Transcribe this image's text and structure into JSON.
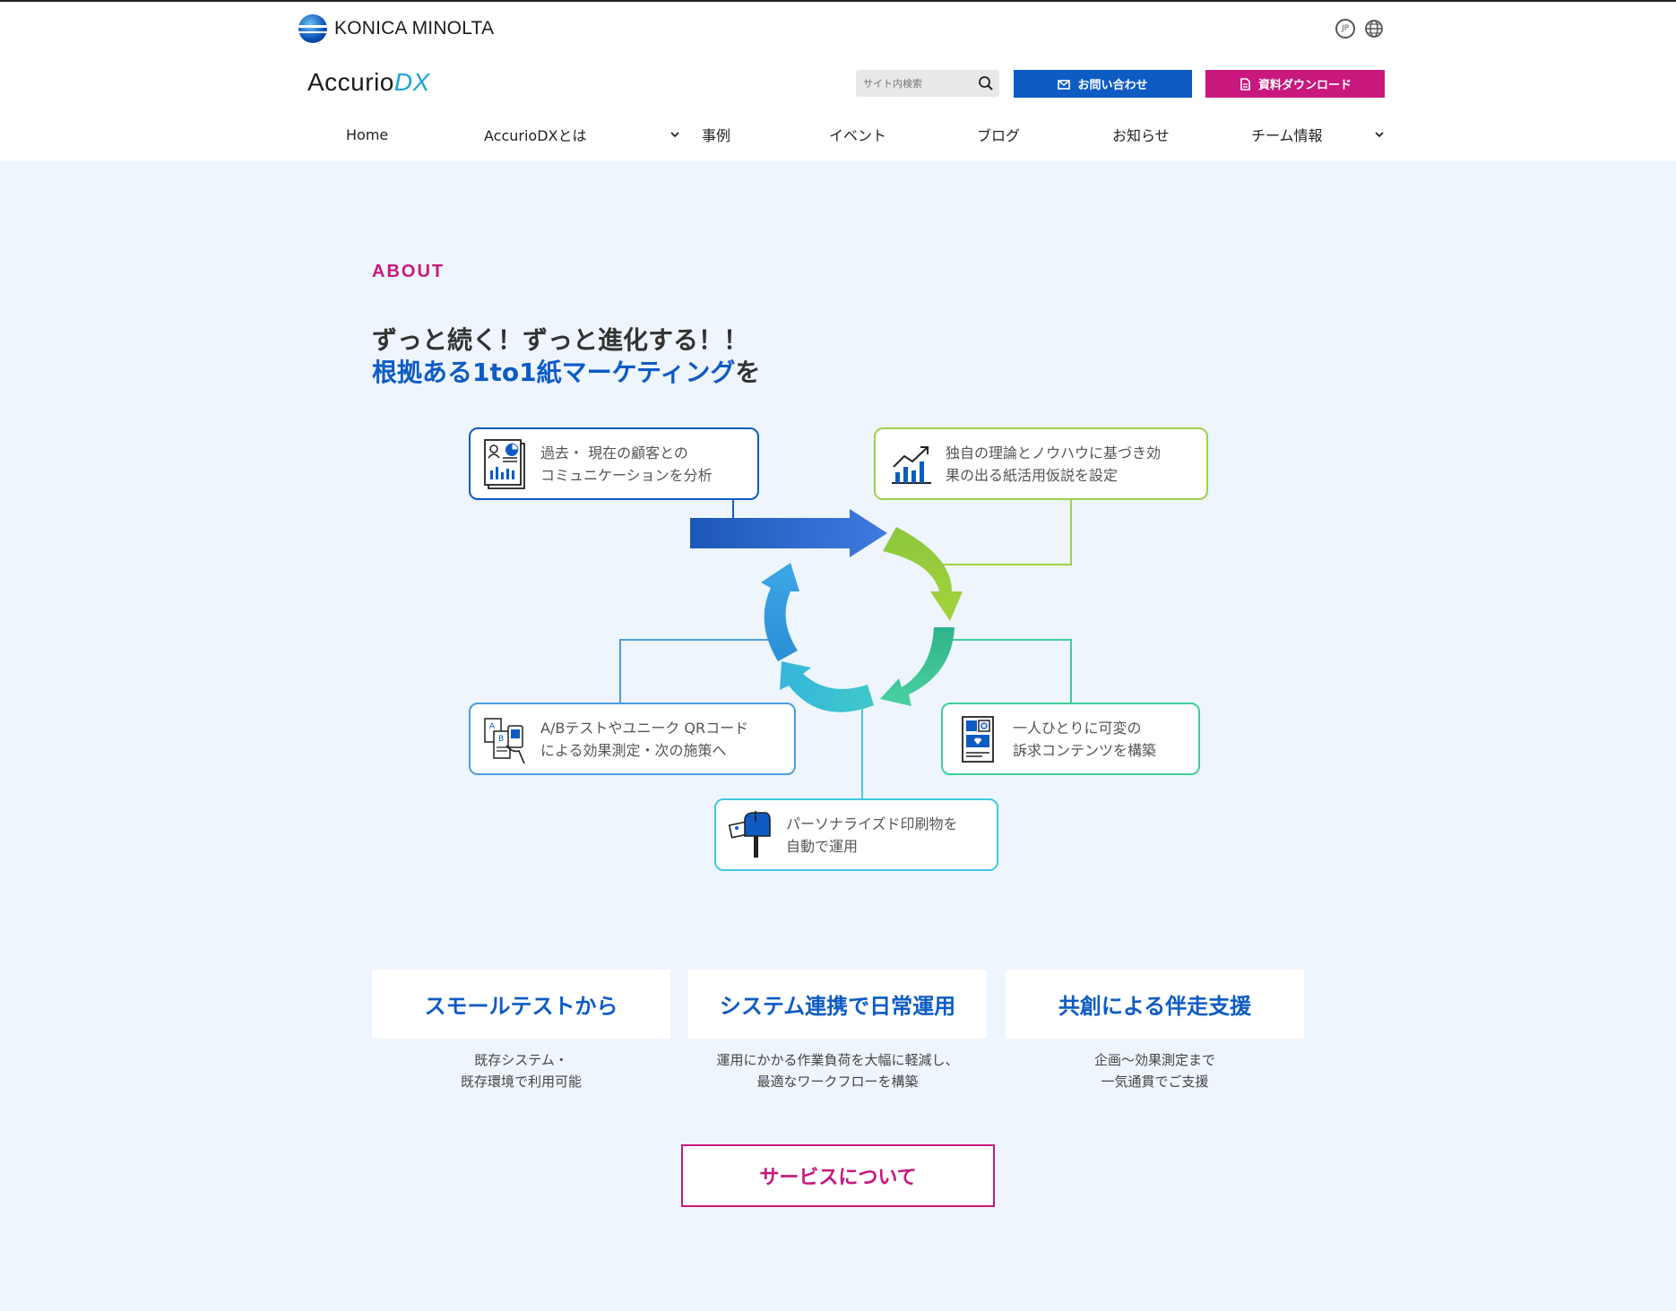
{
  "header": {
    "company_logo_text": "KONICA MINOLTA",
    "lang_label": "JP",
    "brand_main": "Accurio",
    "brand_dx": "DX",
    "search_placeholder": "サイト内検索",
    "contact_label": "お問い合わせ",
    "download_label": "資料ダウンロード"
  },
  "nav": {
    "items": [
      {
        "label": "Home"
      },
      {
        "label": "AccurioDXとは"
      },
      {
        "label": "事例"
      },
      {
        "label": "イベント"
      },
      {
        "label": "ブログ"
      },
      {
        "label": "お知らせ"
      },
      {
        "label": "チーム情報"
      }
    ]
  },
  "about": {
    "label": "ABOUT",
    "headline_line1": "ずっと続く！ずっと進化する！！",
    "headline_line2_highlight": "根拠ある1to1紙マーケティング",
    "headline_line2_suffix": "を"
  },
  "cycle": {
    "steps": [
      {
        "line1": "過去・ 現在の顧客との",
        "line2": "コミュニケーションを分析",
        "color": "#0e5bc4"
      },
      {
        "line1": "独自の理論とノウハウに基づき効",
        "line2": "果の出る紙活用仮説を設定",
        "color": "#9cd24a"
      },
      {
        "line1": "一人ひとりに可変の",
        "line2": "訴求コンテンツを構築",
        "color": "#3ccf9a"
      },
      {
        "line1": "パーソナライズド印刷物を",
        "line2": "自動で運用",
        "color": "#40c9dc"
      },
      {
        "line1": "A/Bテストやユニーク QRコード",
        "line2": "による効果測定・次の施策へ",
        "color": "#4a9ee0"
      }
    ]
  },
  "features": [
    {
      "title": "スモールテストから",
      "desc1": "既存システム・",
      "desc2": "既存環境で利用可能"
    },
    {
      "title": "システム連携で日常運用",
      "desc1": "運用にかかる作業負荷を大幅に軽減し、",
      "desc2": "最適なワークフローを構築"
    },
    {
      "title": "共創による伴走支援",
      "desc1": "企画〜効果測定まで",
      "desc2": "一気通貫でご支援"
    }
  ],
  "service_button": "サービスについて"
}
